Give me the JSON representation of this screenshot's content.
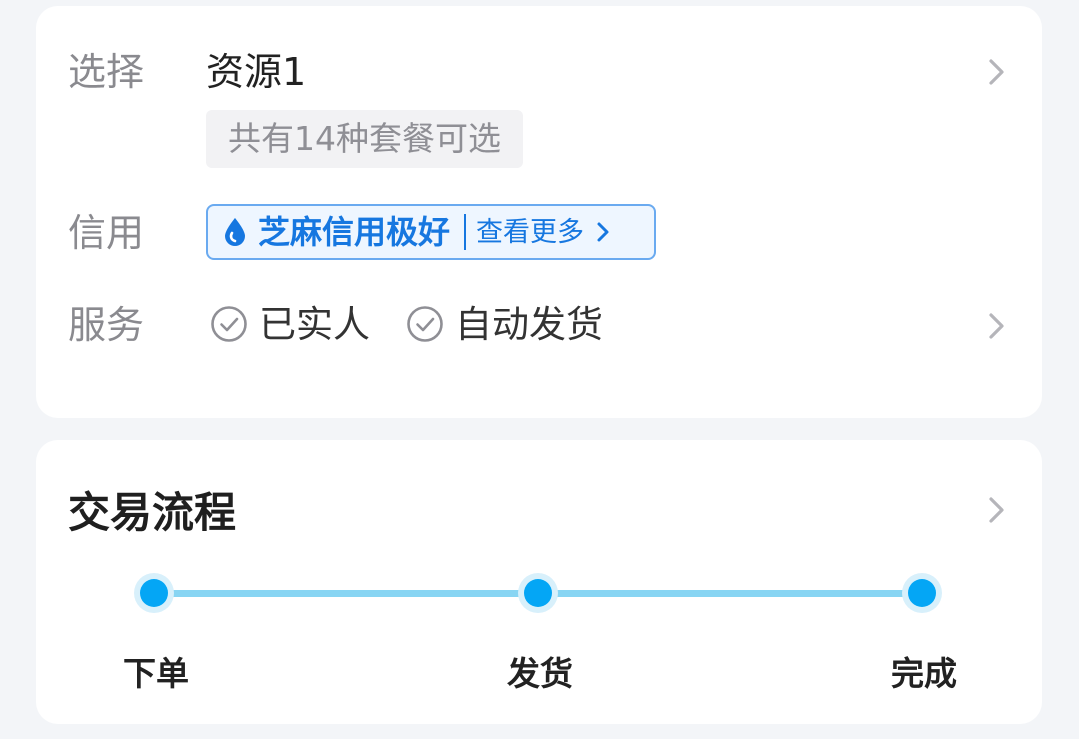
{
  "options": {
    "select_label": "选择",
    "select_value": "资源1",
    "packages_note": "共有14种套餐可选",
    "credit_label": "信用",
    "credit_badge_text": "芝麻信用极好",
    "credit_more_text": "查看更多",
    "service_label": "服务",
    "services": [
      "已实人",
      "自动发货"
    ]
  },
  "flow": {
    "title": "交易流程",
    "steps": [
      "下单",
      "发货",
      "完成"
    ]
  },
  "colors": {
    "accent_blue": "#1677e0",
    "step_dot": "#04a6f5",
    "step_track": "#88d5f3"
  }
}
